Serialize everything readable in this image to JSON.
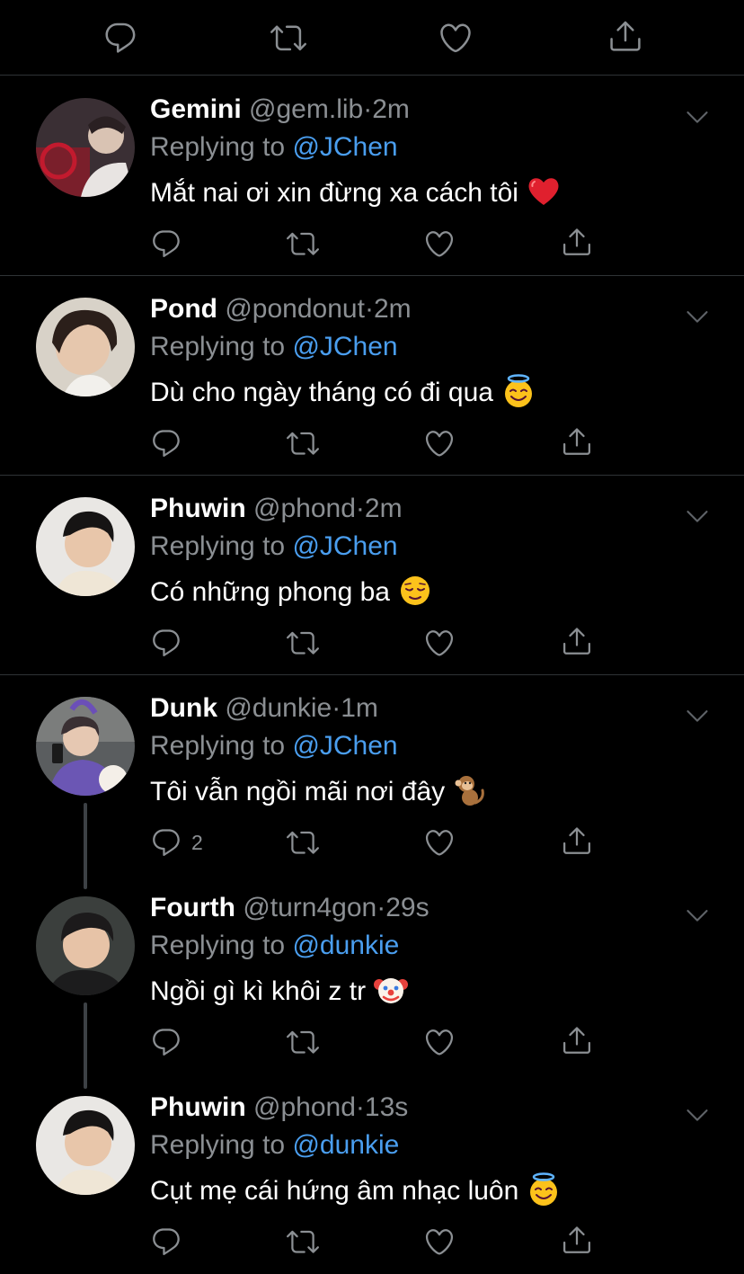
{
  "top_actions": {
    "icons": [
      "reply-icon",
      "retweet-icon",
      "like-icon",
      "share-icon"
    ]
  },
  "colors": {
    "background": "#000000",
    "handle": "#8b8f93",
    "mention": "#4a9eef",
    "divider": "#2f3336"
  },
  "tweets": [
    {
      "name": "Gemini",
      "handle": "@gem.lib",
      "time": "2m",
      "replying_prefix": "Replying to ",
      "mention": "@JChen",
      "text": "Mắt nai ơi xin đừng xa cách tôi",
      "emoji": "red-heart",
      "reply_count": ""
    },
    {
      "name": "Pond",
      "handle": "@pondonut",
      "time": "2m",
      "replying_prefix": "Replying to ",
      "mention": "@JChen",
      "text": "Dù cho ngày tháng có đi qua",
      "emoji": "smiling-face-with-halo",
      "reply_count": ""
    },
    {
      "name": "Phuwin",
      "handle": "@phond",
      "time": "2m",
      "replying_prefix": "Replying to ",
      "mention": "@JChen",
      "text": "Có những phong ba",
      "emoji": "relieved-face",
      "reply_count": ""
    },
    {
      "name": "Dunk",
      "handle": "@dunkie",
      "time": "1m",
      "replying_prefix": "Replying to ",
      "mention": "@JChen",
      "text": "Tôi vẫn ngồi mãi nơi đây",
      "emoji": "monkey",
      "reply_count": "2"
    },
    {
      "name": "Fourth",
      "handle": "@turn4gon",
      "time": "29s",
      "replying_prefix": "Replying to ",
      "mention": "@dunkie",
      "text": "Ngồi gì kì khôi z tr",
      "emoji": "clown-face",
      "reply_count": ""
    },
    {
      "name": "Phuwin",
      "handle": "@phond",
      "time": "13s",
      "replying_prefix": "Replying to ",
      "mention": "@dunkie",
      "text": "Cụt mẹ cái hứng âm nhạc luôn",
      "emoji": "smiling-face-with-halo",
      "reply_count": ""
    }
  ]
}
